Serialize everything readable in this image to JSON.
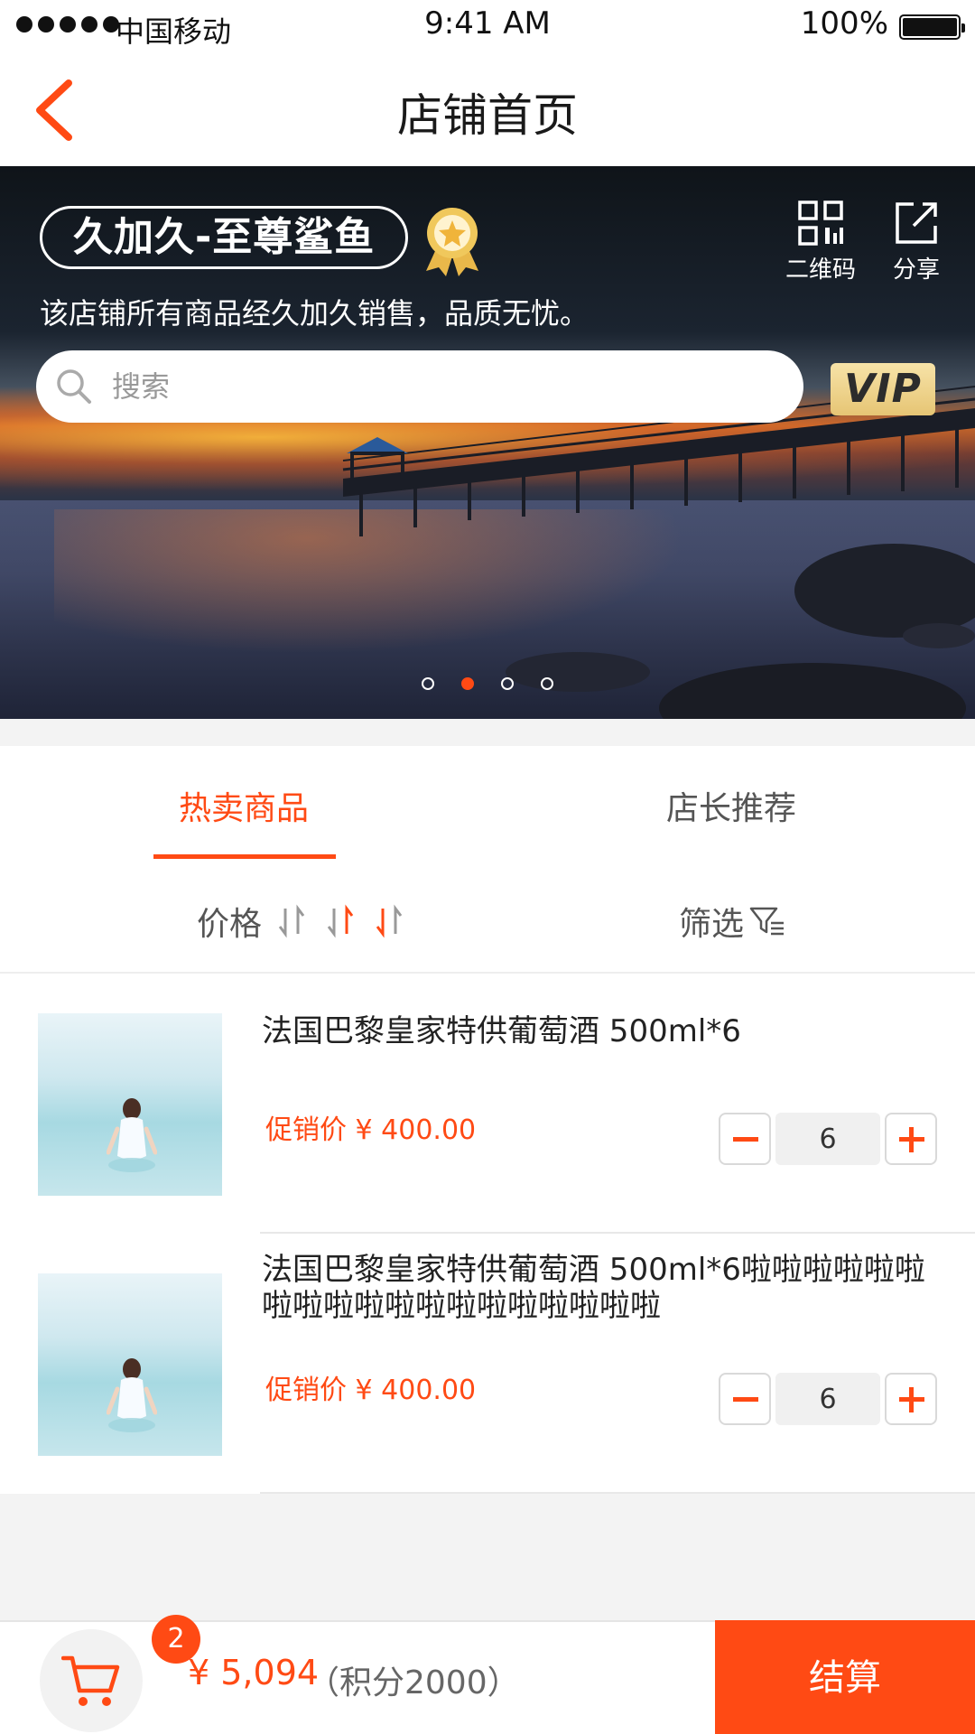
{
  "status_bar": {
    "carrier": "中国移动",
    "time": "9:41 AM",
    "battery": "100%"
  },
  "nav": {
    "title": "店铺首页",
    "back_icon": "chevron-left-icon"
  },
  "shop": {
    "name": "久加久-至尊鲨鱼",
    "description": "该店铺所有商品经久加久销售，品质无忧。",
    "qr_label": "二维码",
    "share_label": "分享",
    "vip_label": "VIP",
    "search_placeholder": "搜索",
    "search_value": "",
    "carousel": {
      "count": 4,
      "active_index": 1
    }
  },
  "tabs": [
    {
      "label": "热卖商品",
      "active": true
    },
    {
      "label": "店长推荐",
      "active": false
    }
  ],
  "sort": {
    "price_label": "价格",
    "filter_label": "筛选"
  },
  "products": [
    {
      "name": "法国巴黎皇家特供葡萄酒 500ml*6",
      "price": "促销价 ¥ 400.00",
      "quantity": "6"
    },
    {
      "name": "法国巴黎皇家特供葡萄酒 500ml*6啦啦啦啦啦啦啦啦啦啦啦啦啦啦啦啦啦啦啦",
      "price": "促销价 ¥ 400.00",
      "quantity": "6"
    }
  ],
  "cart": {
    "badge_count": "2",
    "total": "¥ 5,094",
    "points": "（积分2000）",
    "checkout_label": "结算"
  },
  "colors": {
    "accent": "#ff4a14",
    "text": "#333333",
    "background": "#f3f3f3"
  }
}
